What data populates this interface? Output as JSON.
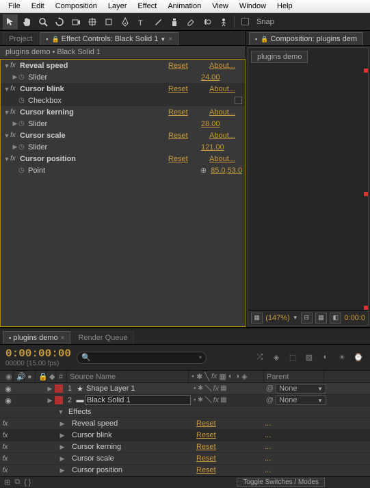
{
  "menu": [
    "File",
    "Edit",
    "Composition",
    "Layer",
    "Effect",
    "Animation",
    "View",
    "Window",
    "Help"
  ],
  "toolbar": {
    "snap_label": "Snap"
  },
  "tabs": {
    "project": "Project",
    "effect_controls": "Effect Controls: Black Solid 1",
    "composition": "Composition: plugins dem"
  },
  "effect_panel": {
    "breadcrumb": "plugins demo • Black Solid 1",
    "reset": "Reset",
    "about": "About...",
    "effects": [
      {
        "name": "Reveal speed",
        "param": "Slider",
        "param_type": "slider",
        "value": "24.00"
      },
      {
        "name": "Cursor blink",
        "param": "Checkbox",
        "param_type": "checkbox",
        "value": "",
        "selected": true
      },
      {
        "name": "Cursor kerning",
        "param": "Slider",
        "param_type": "slider",
        "value": "28.00"
      },
      {
        "name": "Cursor scale",
        "param": "Slider",
        "param_type": "slider",
        "value": "121.00"
      },
      {
        "name": "Cursor position",
        "param": "Point",
        "param_type": "point",
        "value": "85.0,53.0"
      }
    ]
  },
  "comp_panel": {
    "tab": "plugins demo",
    "zoom": "(147%)",
    "time": "0:00:0"
  },
  "timeline": {
    "tabs": {
      "active": "plugins demo",
      "inactive": "Render Queue"
    },
    "timecode": "0:00:00:00",
    "timecode_sub": "00000 (15.00 fps)",
    "search_placeholder": "",
    "columns": {
      "num": "#",
      "source": "Source Name",
      "parent": "Parent"
    },
    "layers": [
      {
        "num": "1",
        "color": "#b03030",
        "icon": "star",
        "name": "Shape Layer 1",
        "parent": "None"
      },
      {
        "num": "2",
        "color": "#b03030",
        "icon": "solid",
        "name": "Black Solid 1",
        "parent": "None",
        "selected": true
      }
    ],
    "effects_label": "Effects",
    "sub_effects": [
      {
        "name": "Reveal speed",
        "reset": "Reset",
        "dots": "..."
      },
      {
        "name": "Cursor blink",
        "reset": "Reset",
        "dots": "...",
        "selected": true
      },
      {
        "name": "Cursor kerning",
        "reset": "Reset",
        "dots": "..."
      },
      {
        "name": "Cursor scale",
        "reset": "Reset",
        "dots": "..."
      },
      {
        "name": "Cursor position",
        "reset": "Reset",
        "dots": "..."
      }
    ],
    "toggle": "Toggle Switches / Modes"
  }
}
